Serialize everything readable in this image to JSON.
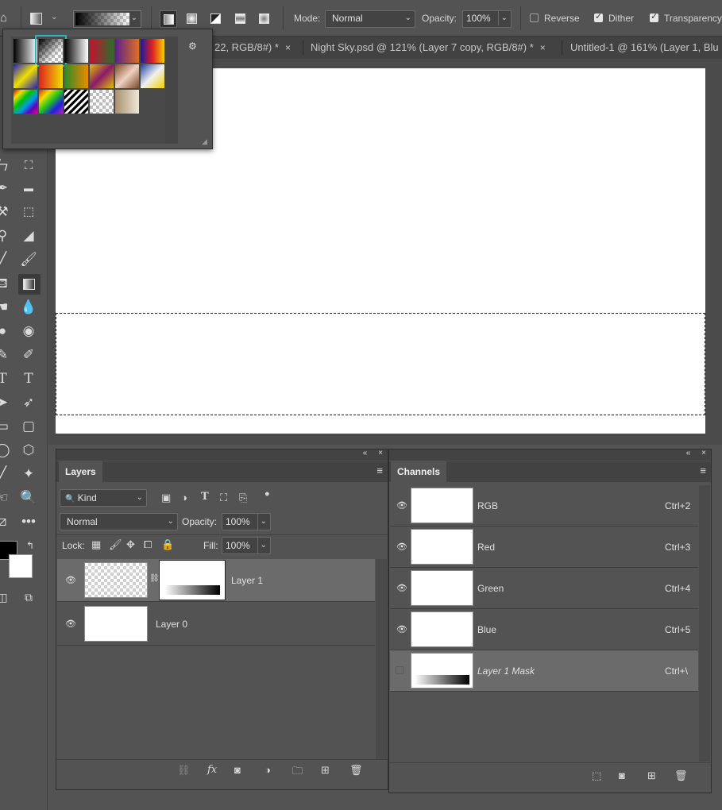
{
  "options": {
    "mode_label": "Mode:",
    "mode_value": "Normal",
    "opacity_label": "Opacity:",
    "opacity_value": "100%",
    "reverse_label": "Reverse",
    "reverse_checked": false,
    "dither_label": "Dither",
    "dither_checked": true,
    "transparency_label": "Transparency",
    "transparency_checked": true
  },
  "tabs": [
    {
      "label": "22, RGB/8#) *",
      "close": "×"
    },
    {
      "label": "Night Sky.psd @ 121% (Layer 7 copy, RGB/8#) *",
      "close": "×"
    },
    {
      "label": "Untitled-1 @ 161% (Layer 1, Blu",
      "close": ""
    }
  ],
  "gradient_picker": {
    "gear": "⚙",
    "swatches": [
      "linear-gradient(to right,#000,#fff)",
      "checker-black",
      "linear-gradient(to right,#000,#fff)",
      "linear-gradient(to right,#c8102e,#2c6e2c)",
      "linear-gradient(to right,#5a2090,#e07020)",
      "linear-gradient(to right,#1a1aa0,#e02020,#f5d000)",
      "linear-gradient(135deg,#2020c0,#f0e000,#2020c0)",
      "linear-gradient(to right,#e02020,#f0e000)",
      "linear-gradient(to right,#2a8a2a,#f08a00)",
      "linear-gradient(135deg,#e0c000,#8a1a6a,#e0c000)",
      "linear-gradient(135deg,#7a4a2a,#f0d0c0,#7a4a2a)",
      "linear-gradient(135deg,#2040a0,#f0f0f0,#f0d000)",
      "linear-gradient(135deg,#e00000,#f0e000,#00c000,#00a0e0,#6000c0,#e000a0)",
      "linear-gradient(135deg,#e02020,#f0e000,#20c020,#2020e0,#c020c0)",
      "stripes",
      "checker-gray",
      "linear-gradient(to right,#a89070,#f0e6d6)"
    ]
  },
  "layers_panel": {
    "tab": "Layers",
    "filter_label": "Kind",
    "blend_mode": "Normal",
    "opacity_label": "Opacity:",
    "opacity_value": "100%",
    "lock_label": "Lock:",
    "fill_label": "Fill:",
    "fill_value": "100%",
    "layers": [
      {
        "name": "Layer 1"
      },
      {
        "name": "Layer 0"
      }
    ]
  },
  "channels_panel": {
    "tab": "Channels",
    "channels": [
      {
        "name": "RGB",
        "shortcut": "Ctrl+2"
      },
      {
        "name": "Red",
        "shortcut": "Ctrl+3"
      },
      {
        "name": "Green",
        "shortcut": "Ctrl+4"
      },
      {
        "name": "Blue",
        "shortcut": "Ctrl+5"
      },
      {
        "name": "Layer 1 Mask",
        "shortcut": "Ctrl+\\"
      }
    ]
  },
  "colors": {
    "selection_highlight": "#26b7c7",
    "foreground": "#000000",
    "background": "#ffffff"
  }
}
